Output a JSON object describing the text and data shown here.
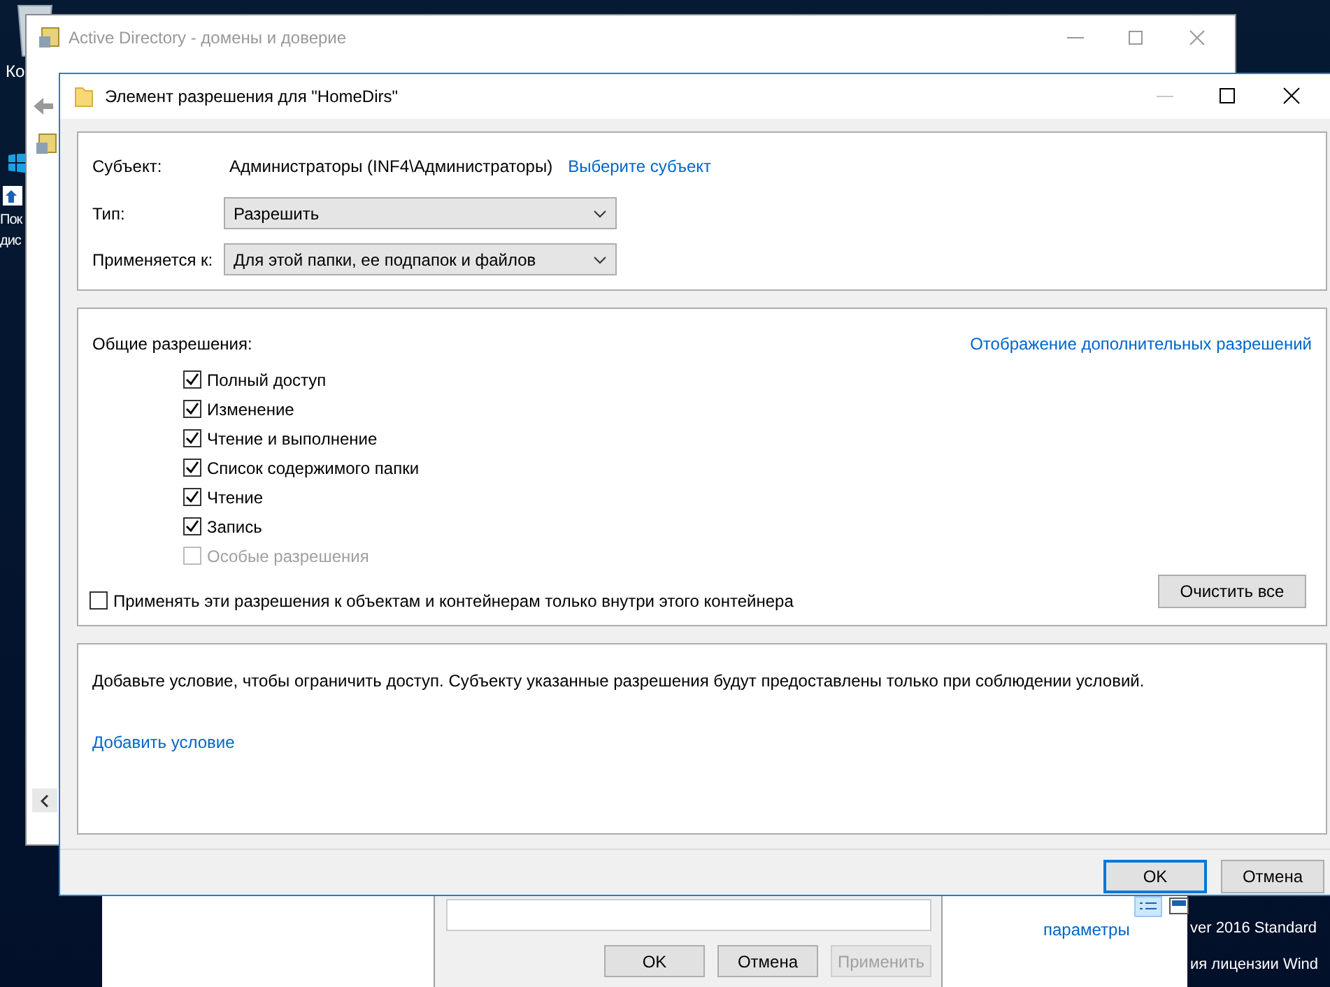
{
  "desktop": {
    "icon_labels": [
      "Ко",
      "Пок",
      "дис"
    ],
    "system_text": [
      "ver 2016 Standard",
      "ия лицензии Wind"
    ]
  },
  "back_window": {
    "title": "Active Directory - домены и доверие"
  },
  "explorer": {
    "link": "параметры"
  },
  "properties_dialog": {
    "buttons": [
      {
        "label": "OK",
        "disabled": false
      },
      {
        "label": "Отмена",
        "disabled": false
      },
      {
        "label": "Применить",
        "disabled": true
      }
    ]
  },
  "dialog": {
    "title": "Элемент разрешения для \"HomeDirs\"",
    "subject": {
      "label": "Субъект:",
      "value": "Администраторы (INF4\\Администраторы)",
      "link": "Выберите субъект"
    },
    "type": {
      "label": "Тип:",
      "value": "Разрешить"
    },
    "applies_to": {
      "label": "Применяется к:",
      "value": "Для этой папки, ее подпапок и файлов"
    },
    "permissions": {
      "label": "Общие разрешения:",
      "link": "Отображение дополнительных разрешений",
      "items": [
        {
          "label": "Полный доступ",
          "checked": true,
          "disabled": false
        },
        {
          "label": "Изменение",
          "checked": true,
          "disabled": false
        },
        {
          "label": "Чтение и выполнение",
          "checked": true,
          "disabled": false
        },
        {
          "label": "Список содержимого папки",
          "checked": true,
          "disabled": false
        },
        {
          "label": "Чтение",
          "checked": true,
          "disabled": false
        },
        {
          "label": "Запись",
          "checked": true,
          "disabled": false
        },
        {
          "label": "Особые разрешения",
          "checked": false,
          "disabled": true
        }
      ],
      "inherit_option": {
        "label": "Применять эти разрешения к объектам и контейнерам только внутри этого контейнера",
        "checked": false
      },
      "clear_button": "Очистить все"
    },
    "conditions": {
      "text": "Добавьте условие, чтобы ограничить доступ. Субъекту указанные разрешения будут предоставлены только при соблюдении условий.",
      "link": "Добавить условие"
    },
    "buttons": [
      {
        "label": "OK",
        "default": true
      },
      {
        "label": "Отмена",
        "default": false
      }
    ]
  }
}
